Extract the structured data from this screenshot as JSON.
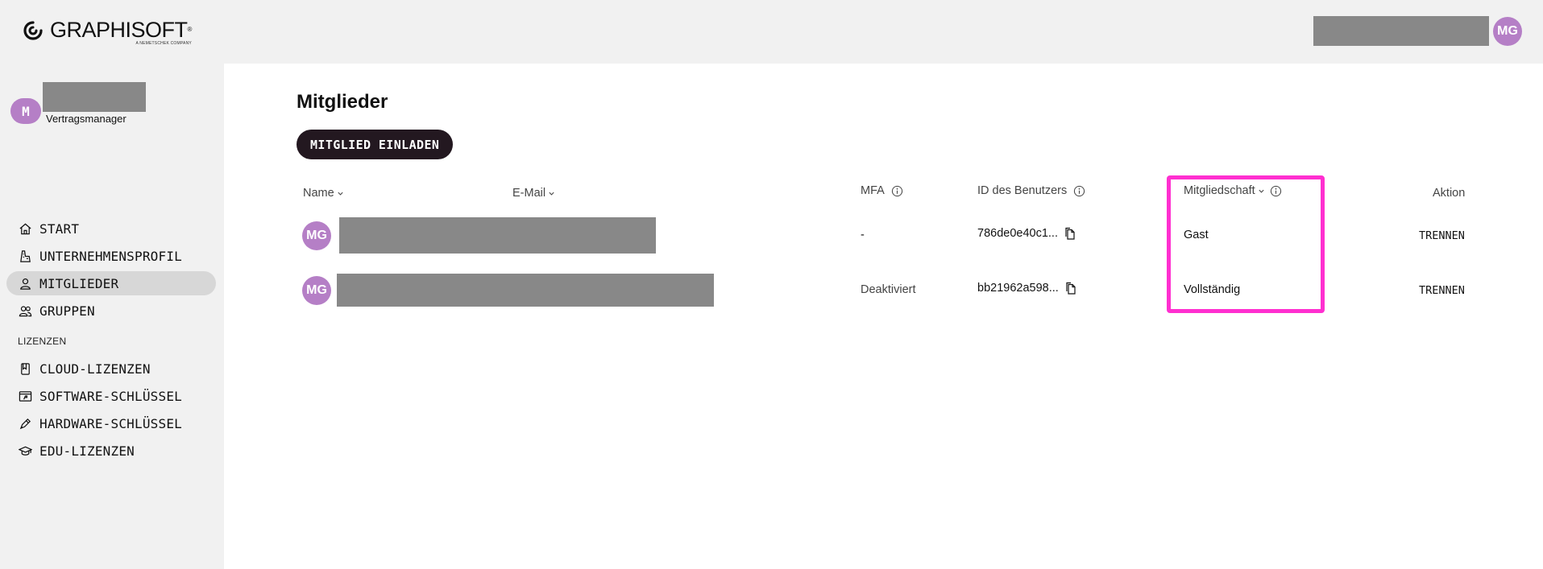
{
  "header": {
    "logo_text": "GRAPHISOFT",
    "logo_trademark": "®",
    "logo_sub": "A NEMETSCHEK COMPANY",
    "user_initials": "MG"
  },
  "sidebar": {
    "user_initial": "M",
    "user_role": "Vertragsmanager",
    "items": [
      {
        "label": "START",
        "icon": "home-icon",
        "active": false
      },
      {
        "label": "UNTERNEHMENSPROFIL",
        "icon": "building-icon",
        "active": false
      },
      {
        "label": "MITGLIEDER",
        "icon": "user-icon",
        "active": true
      },
      {
        "label": "GRUPPEN",
        "icon": "users-icon",
        "active": false
      }
    ],
    "section_label": "LIZENZEN",
    "license_items": [
      {
        "label": "CLOUD-LIZENZEN",
        "icon": "cloud-license-icon"
      },
      {
        "label": "SOFTWARE-SCHLÜSSEL",
        "icon": "software-key-icon"
      },
      {
        "label": "HARDWARE-SCHLÜSSEL",
        "icon": "hardware-key-icon"
      },
      {
        "label": "EDU-LIZENZEN",
        "icon": "graduation-cap-icon"
      }
    ]
  },
  "main": {
    "title": "Mitglieder",
    "invite_button": "MITGLIED EINLADEN",
    "columns": {
      "name": "Name",
      "email": "E-Mail",
      "mfa": "MFA",
      "user_id": "ID des Benutzers",
      "membership": "Mitgliedschaft",
      "action": "Aktion"
    },
    "rows": [
      {
        "initials": "MG",
        "mfa": "-",
        "user_id": "786de0e40c1...",
        "membership": "Gast",
        "action": "TRENNEN"
      },
      {
        "initials": "MG",
        "mfa": "Deaktiviert",
        "user_id": "bb21962a598...",
        "membership": "Vollständig",
        "action": "TRENNEN"
      }
    ]
  },
  "colors": {
    "avatar": "#b57fc6",
    "highlight": "#ff2fd0",
    "button_bg": "#231820",
    "active_nav": "#d7d7d7"
  }
}
